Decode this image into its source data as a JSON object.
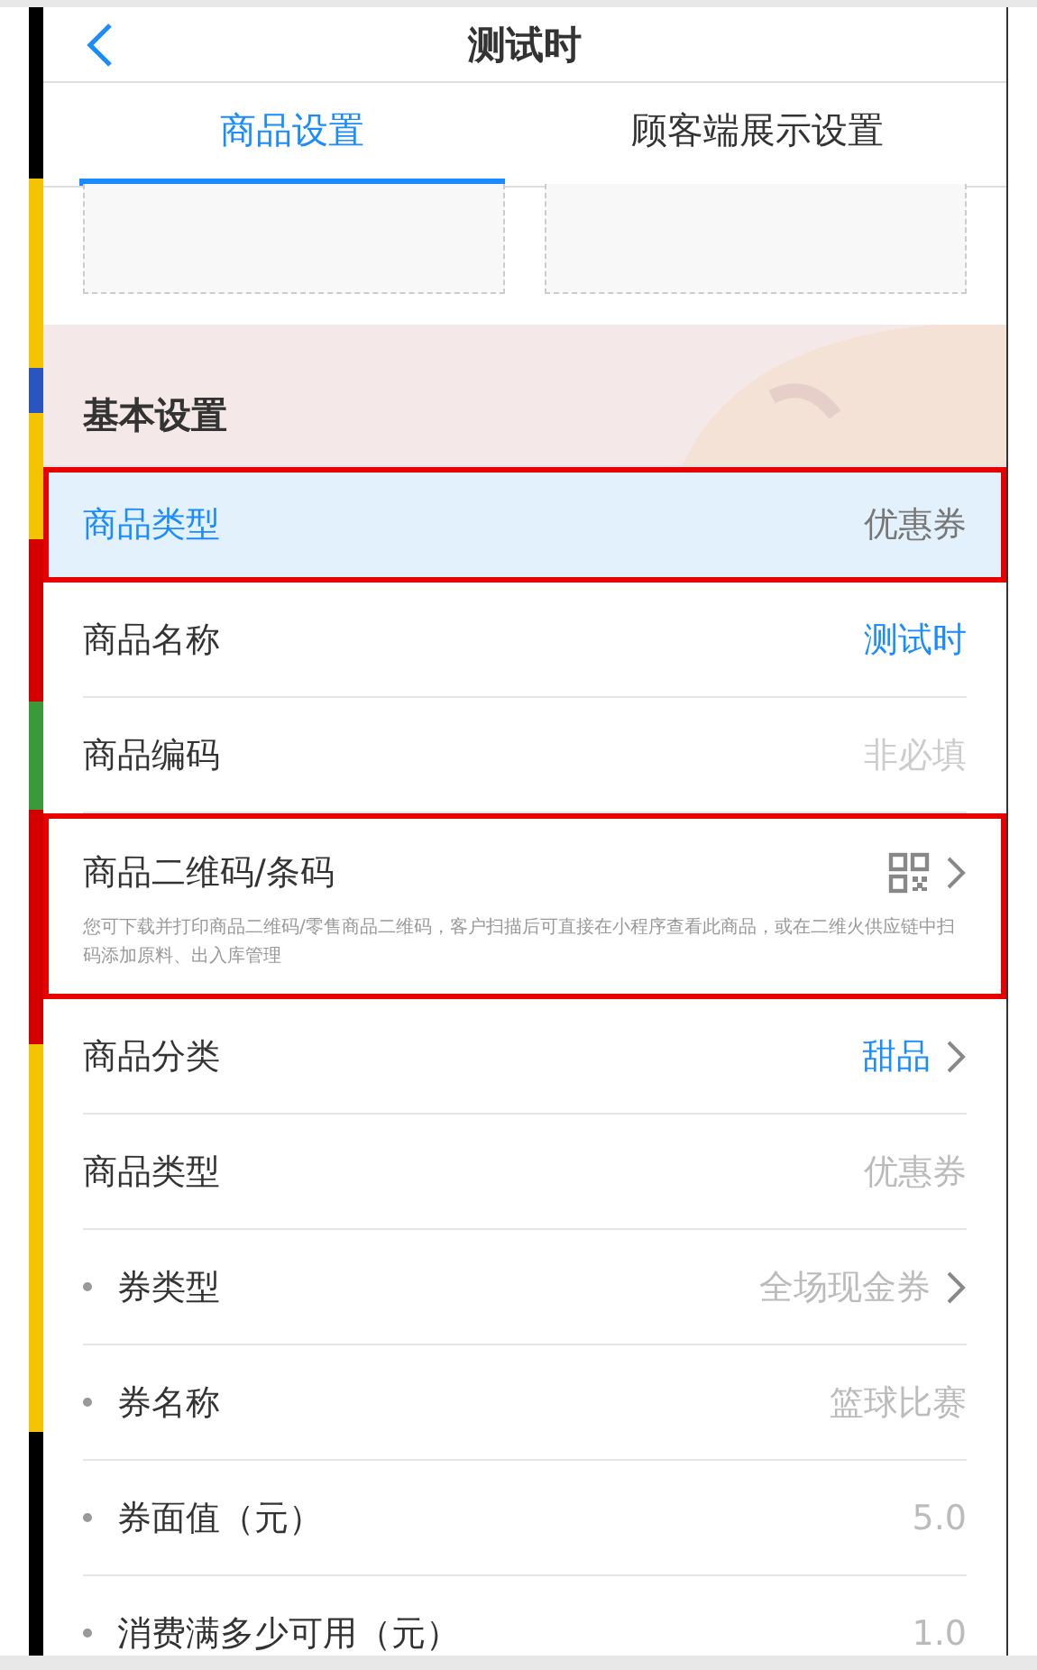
{
  "header": {
    "title": "测试时"
  },
  "tabs": [
    {
      "label": "商品设置",
      "selected": true
    },
    {
      "label": "顾客端展示设置",
      "selected": false
    }
  ],
  "section": {
    "title": "基本设置"
  },
  "rows": [
    {
      "kind": "text",
      "label": "商品类型",
      "value": "优惠券",
      "selected": true,
      "outlined": true,
      "bullet": false,
      "chevron": false
    },
    {
      "kind": "link",
      "label": "商品名称",
      "value": "测试时",
      "selected": false,
      "outlined": false,
      "bullet": false,
      "chevron": false
    },
    {
      "kind": "input",
      "label": "商品编码",
      "placeholder": "非必填",
      "selected": false,
      "outlined": false,
      "bullet": false,
      "chevron": false
    },
    {
      "kind": "qrcode",
      "label": "商品二维码/条码",
      "note": "您可下载并打印商品二维码/零售商品二维码，客户扫描后可直接在小程序查看此商品，或在二维火供应链中扫码添加原料、出入库管理",
      "selected": false,
      "outlined": true,
      "bullet": false,
      "chevron": true
    },
    {
      "kind": "link",
      "label": "商品分类",
      "value": "甜品",
      "selected": false,
      "outlined": false,
      "bullet": false,
      "chevron": true
    },
    {
      "kind": "disabled",
      "label": "商品类型",
      "value": "优惠券",
      "selected": false,
      "outlined": false,
      "bullet": false,
      "chevron": false
    },
    {
      "kind": "disabled",
      "label": "券类型",
      "value": "全场现金券",
      "selected": false,
      "outlined": false,
      "bullet": true,
      "chevron": true
    },
    {
      "kind": "disabled",
      "label": "券名称",
      "value": "篮球比赛",
      "selected": false,
      "outlined": false,
      "bullet": true,
      "chevron": false
    },
    {
      "kind": "disabled",
      "label": "券面值（元）",
      "value": "5.0",
      "selected": false,
      "outlined": false,
      "bullet": true,
      "chevron": false
    },
    {
      "kind": "disabled",
      "label": "消费满多少可用（元）",
      "value": "1.0",
      "selected": false,
      "outlined": false,
      "bullet": true,
      "chevron": false
    }
  ]
}
